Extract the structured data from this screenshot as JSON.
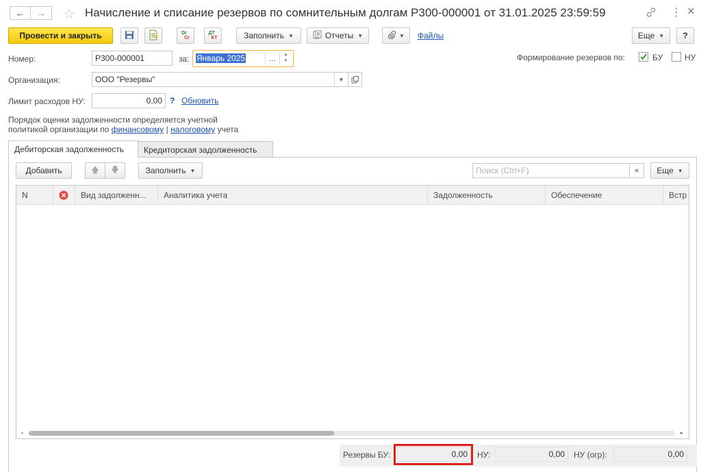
{
  "window": {
    "title": "Начисление и списание резервов по сомнительным долгам Р300-000001 от 31.01.2025 23:59:59",
    "back_glyph": "←",
    "forward_glyph": "→",
    "star_glyph": "☆",
    "link_glyph": "🔗",
    "menu_glyph": "⋮",
    "close_glyph": "×"
  },
  "toolbar": {
    "post_and_close": "Провести и закрыть",
    "dr_label": "Dr",
    "cr_label": "Cr",
    "dt_label": "ДТ",
    "kt_label": "КТ",
    "fill": "Заполнить",
    "reports": "Отчеты",
    "files": "Файлы",
    "more": "Еще",
    "help": "?"
  },
  "form": {
    "number_label": "Номер:",
    "number_value": "Р300-000001",
    "period_label": "за:",
    "period_value": "Январь 2025",
    "period_select": "...",
    "reserves_label": "Формирование резервов по:",
    "bu_label": "БУ",
    "bu_checked": true,
    "nu_label": "НУ",
    "nu_checked": false,
    "org_label": "Организация:",
    "org_value": "ООО \"Резервы\"",
    "limit_label": "Лимит расходов НУ:",
    "limit_value": "0,00",
    "limit_help": "?",
    "limit_update": "Обновить",
    "note_line1": "Порядок оценки задолженности определяется учетной",
    "note_line2_prefix": "политикой организации по ",
    "note_link1": "финансовому",
    "note_sep": " | ",
    "note_link2": "налоговому",
    "note_suffix": " учета"
  },
  "tabs": [
    {
      "label": "Дебиторская задолженность",
      "active": true
    },
    {
      "label": "Кредиторская задолженность",
      "active": false
    }
  ],
  "table_toolbar": {
    "add": "Добавить",
    "fill": "Заполнить",
    "search_placeholder": "Поиск (Ctrl+F)",
    "more": "Еще"
  },
  "table": {
    "columns": [
      "N",
      "",
      "Вид задолженн...",
      "Аналитика учета",
      "Задолженность",
      "Обеспечение",
      "Встр"
    ],
    "rows": []
  },
  "footer": {
    "bu_label": "Резервы БУ:",
    "bu_value": "0,00",
    "nu_label": "НУ:",
    "nu_value": "0,00",
    "nu_limited_label": "НУ (огр):",
    "nu_limited_value": "0,00"
  },
  "colors": {
    "primary_button": "#f5c90a",
    "link": "#1a52b3",
    "checkbox_check": "#2e9e3e",
    "error_icon": "#e24a3b",
    "highlight_border": "#e0201a",
    "period_focus": "#f2b930",
    "selection": "#3f6fd1"
  }
}
